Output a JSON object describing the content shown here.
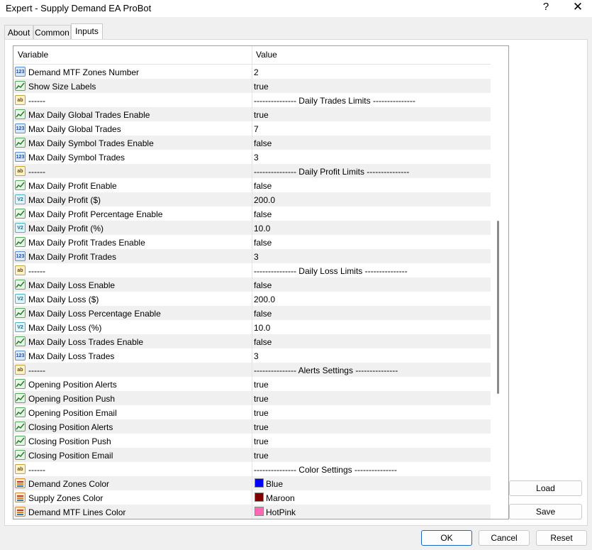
{
  "window": {
    "title": "Expert - Supply Demand EA ProBot",
    "help": "?",
    "close": "✕"
  },
  "tabs": [
    {
      "label": "About"
    },
    {
      "label": "Common"
    },
    {
      "label": "Inputs"
    }
  ],
  "grid": {
    "headers": {
      "variable": "Variable",
      "value": "Value"
    },
    "rows": [
      {
        "icon": "int",
        "glyph": "123",
        "name": "Demand MTF Zones Number",
        "value": "2"
      },
      {
        "icon": "bool",
        "glyph": "",
        "name": "Show Size Labels",
        "value": "true"
      },
      {
        "icon": "str",
        "glyph": "ab",
        "name": "------",
        "value": "--------------- Daily Trades Limits ---------------"
      },
      {
        "icon": "bool",
        "glyph": "",
        "name": "Max Daily Global Trades Enable",
        "value": "true"
      },
      {
        "icon": "int",
        "glyph": "123",
        "name": "Max Daily Global Trades",
        "value": "7"
      },
      {
        "icon": "bool",
        "glyph": "",
        "name": "Max Daily Symbol Trades Enable",
        "value": "false"
      },
      {
        "icon": "int",
        "glyph": "123",
        "name": "Max Daily Symbol Trades",
        "value": "3"
      },
      {
        "icon": "str",
        "glyph": "ab",
        "name": "------",
        "value": "--------------- Daily Profit Limits ---------------"
      },
      {
        "icon": "bool",
        "glyph": "",
        "name": "Max Daily Profit Enable",
        "value": "false"
      },
      {
        "icon": "dbl",
        "glyph": "V2",
        "name": "Max Daily Profit ($)",
        "value": "200.0"
      },
      {
        "icon": "bool",
        "glyph": "",
        "name": "Max Daily Profit Percentage Enable",
        "value": "false"
      },
      {
        "icon": "dbl",
        "glyph": "V2",
        "name": "Max Daily Profit (%)",
        "value": "10.0"
      },
      {
        "icon": "bool",
        "glyph": "",
        "name": "Max Daily Profit Trades Enable",
        "value": "false"
      },
      {
        "icon": "int",
        "glyph": "123",
        "name": "Max Daily Profit Trades",
        "value": "3"
      },
      {
        "icon": "str",
        "glyph": "ab",
        "name": "------",
        "value": "--------------- Daily Loss Limits ---------------"
      },
      {
        "icon": "bool",
        "glyph": "",
        "name": "Max Daily Loss Enable",
        "value": "false"
      },
      {
        "icon": "dbl",
        "glyph": "V2",
        "name": "Max Daily Loss ($)",
        "value": "200.0"
      },
      {
        "icon": "bool",
        "glyph": "",
        "name": "Max Daily Loss Percentage Enable",
        "value": "false"
      },
      {
        "icon": "dbl",
        "glyph": "V2",
        "name": "Max Daily Loss (%)",
        "value": "10.0"
      },
      {
        "icon": "bool",
        "glyph": "",
        "name": "Max Daily Loss Trades Enable",
        "value": "false"
      },
      {
        "icon": "int",
        "glyph": "123",
        "name": "Max Daily Loss Trades",
        "value": "3"
      },
      {
        "icon": "str",
        "glyph": "ab",
        "name": "------",
        "value": "--------------- Alerts Settings ---------------"
      },
      {
        "icon": "bool",
        "glyph": "",
        "name": "Opening Position  Alerts",
        "value": "true"
      },
      {
        "icon": "bool",
        "glyph": "",
        "name": "Opening Position  Push",
        "value": "true"
      },
      {
        "icon": "bool",
        "glyph": "",
        "name": "Opening Position  Email",
        "value": "true"
      },
      {
        "icon": "bool",
        "glyph": "",
        "name": "Closing Position  Alerts",
        "value": "true"
      },
      {
        "icon": "bool",
        "glyph": "",
        "name": "Closing Position  Push",
        "value": "true"
      },
      {
        "icon": "bool",
        "glyph": "",
        "name": "Closing Position  Email",
        "value": "true"
      },
      {
        "icon": "str",
        "glyph": "ab",
        "name": "------",
        "value": "--------------- Color Settings ---------------"
      },
      {
        "icon": "clr",
        "glyph": "",
        "name": "Demand Zones Color",
        "value": "Blue",
        "swatch": "#0000ff"
      },
      {
        "icon": "clr",
        "glyph": "",
        "name": "Supply Zones Color",
        "value": "Maroon",
        "swatch": "#800000"
      },
      {
        "icon": "clr",
        "glyph": "",
        "name": "Demand MTF Lines Color",
        "value": "HotPink",
        "swatch": "#ff69b4"
      }
    ]
  },
  "side_buttons": {
    "load": "Load",
    "save": "Save"
  },
  "footer_buttons": {
    "ok": "OK",
    "cancel": "Cancel",
    "reset": "Reset"
  },
  "colors": {
    "accent": "#1a66c9"
  }
}
